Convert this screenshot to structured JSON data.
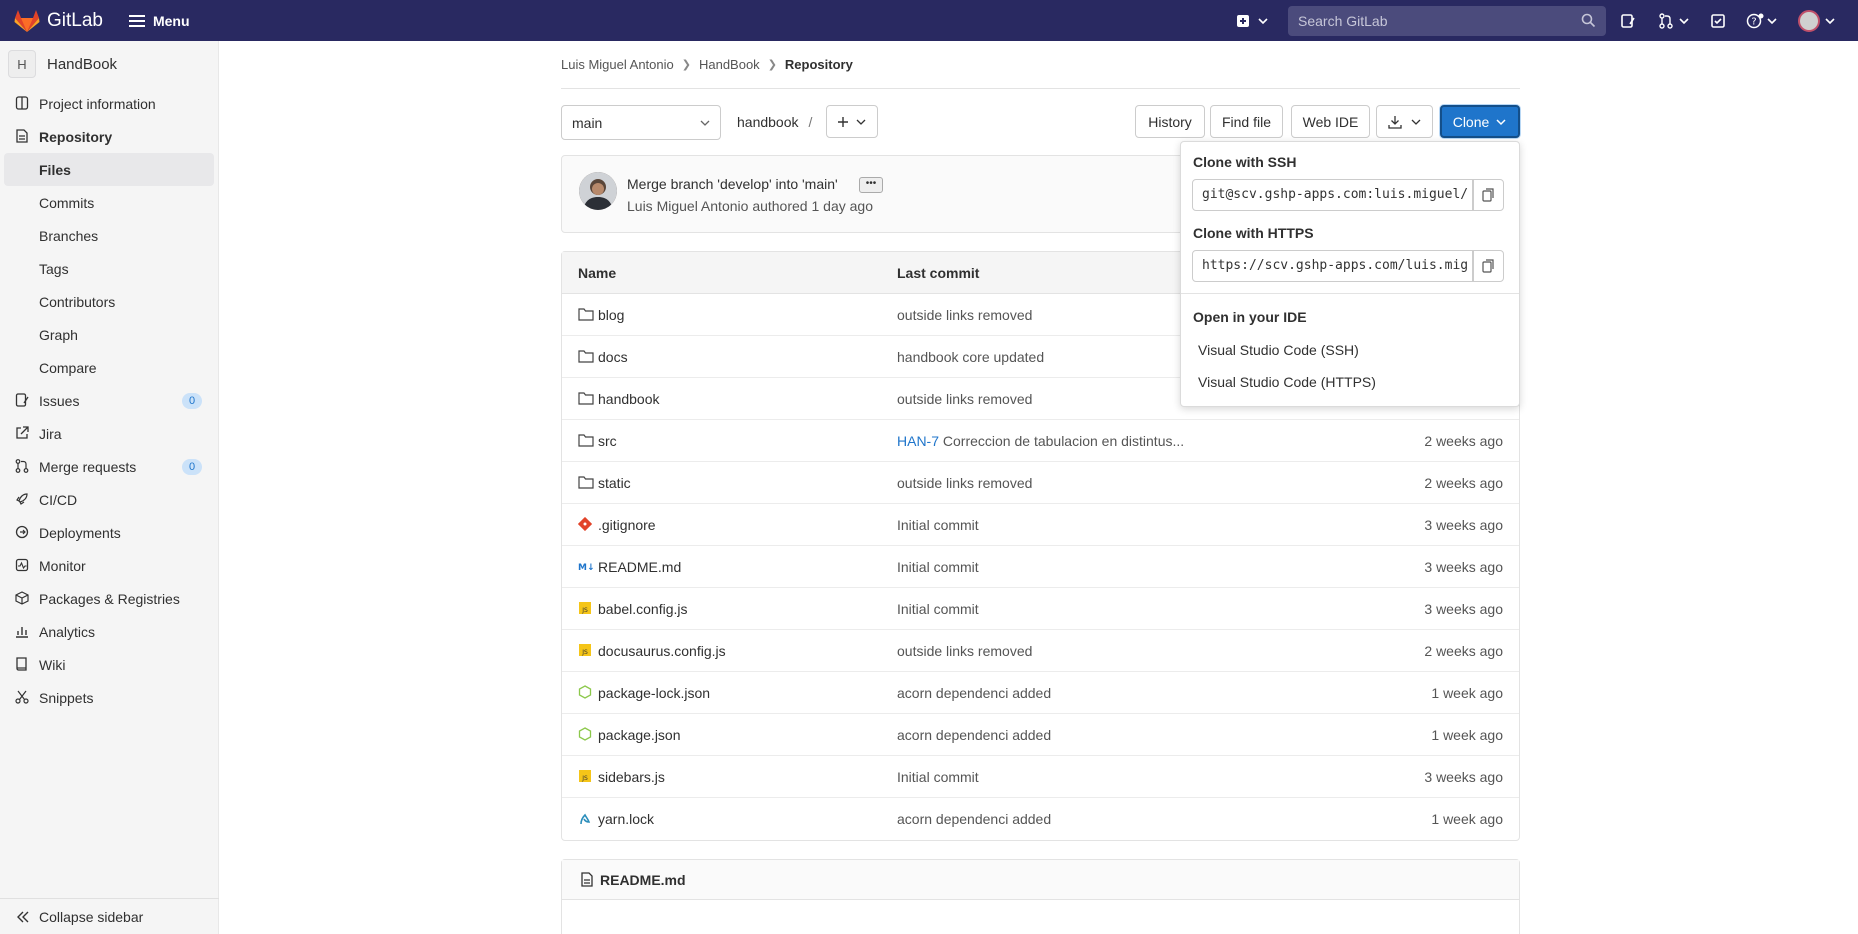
{
  "topbar": {
    "brand": "GitLab",
    "menu_label": "Menu",
    "search_placeholder": "Search GitLab"
  },
  "sidebar": {
    "project_initial": "H",
    "project_name": "HandBook",
    "items": [
      {
        "label": "Project information",
        "icon": "info-icon"
      },
      {
        "label": "Repository",
        "icon": "document-icon"
      },
      {
        "label": "Files"
      },
      {
        "label": "Commits"
      },
      {
        "label": "Branches"
      },
      {
        "label": "Tags"
      },
      {
        "label": "Contributors"
      },
      {
        "label": "Graph"
      },
      {
        "label": "Compare"
      },
      {
        "label": "Issues",
        "icon": "issues-icon",
        "badge": "0"
      },
      {
        "label": "Jira",
        "icon": "external-link-icon"
      },
      {
        "label": "Merge requests",
        "icon": "merge-request-icon",
        "badge": "0"
      },
      {
        "label": "CI/CD",
        "icon": "rocket-icon"
      },
      {
        "label": "Deployments",
        "icon": "deployments-icon"
      },
      {
        "label": "Monitor",
        "icon": "monitor-icon"
      },
      {
        "label": "Packages & Registries",
        "icon": "package-icon"
      },
      {
        "label": "Analytics",
        "icon": "chart-icon"
      },
      {
        "label": "Wiki",
        "icon": "book-icon"
      },
      {
        "label": "Snippets",
        "icon": "scissors-icon"
      }
    ],
    "collapse_label": "Collapse sidebar"
  },
  "breadcrumb": [
    "Luis Miguel Antonio",
    "HandBook",
    "Repository"
  ],
  "toolbar": {
    "branch": "main",
    "path": "handbook",
    "path_sep": "/",
    "history": "History",
    "find_file": "Find file",
    "web_ide": "Web IDE",
    "clone": "Clone"
  },
  "commit": {
    "title": "Merge branch 'develop' into 'main'",
    "author": "Luis Miguel Antonio",
    "authored": "authored",
    "time": "1 day ago"
  },
  "files": {
    "headers": {
      "name": "Name",
      "last_commit": "Last commit"
    },
    "rows": [
      {
        "name": "blog",
        "type": "folder",
        "commit": "outside links removed",
        "time": ""
      },
      {
        "name": "docs",
        "type": "folder",
        "commit": "handbook core updated",
        "time": ""
      },
      {
        "name": "handbook",
        "type": "folder",
        "commit": "outside links removed",
        "time": ""
      },
      {
        "name": "src",
        "type": "folder",
        "issue": "HAN-7",
        "commit": "Correccion de tabulacion en distintus...",
        "time": "2 weeks ago"
      },
      {
        "name": "static",
        "type": "folder",
        "commit": "outside links removed",
        "time": "2 weeks ago"
      },
      {
        "name": ".gitignore",
        "type": "git",
        "commit": "Initial commit",
        "time": "3 weeks ago"
      },
      {
        "name": "README.md",
        "type": "markdown",
        "commit": "Initial commit",
        "time": "3 weeks ago"
      },
      {
        "name": "babel.config.js",
        "type": "js",
        "commit": "Initial commit",
        "time": "3 weeks ago"
      },
      {
        "name": "docusaurus.config.js",
        "type": "js",
        "commit": "outside links removed",
        "time": "2 weeks ago"
      },
      {
        "name": "package-lock.json",
        "type": "npm",
        "commit": "acorn dependenci added",
        "time": "1 week ago"
      },
      {
        "name": "package.json",
        "type": "npm",
        "commit": "acorn dependenci added",
        "time": "1 week ago"
      },
      {
        "name": "sidebars.js",
        "type": "js",
        "commit": "Initial commit",
        "time": "3 weeks ago"
      },
      {
        "name": "yarn.lock",
        "type": "yarn",
        "commit": "acorn dependenci added",
        "time": "1 week ago"
      }
    ]
  },
  "readme": {
    "title": "README.md"
  },
  "clone_dropdown": {
    "ssh_label": "Clone with SSH",
    "ssh_url": "git@scv.gshp-apps.com:luis.miguel/",
    "https_label": "Clone with HTTPS",
    "https_url": "https://scv.gshp-apps.com/luis.mig",
    "ide_label": "Open in your IDE",
    "ide_ssh": "Visual Studio Code (SSH)",
    "ide_https": "Visual Studio Code (HTTPS)"
  },
  "colors": {
    "topbar": "#292961",
    "primary": "#1f75cb",
    "logo": "#e24329"
  }
}
